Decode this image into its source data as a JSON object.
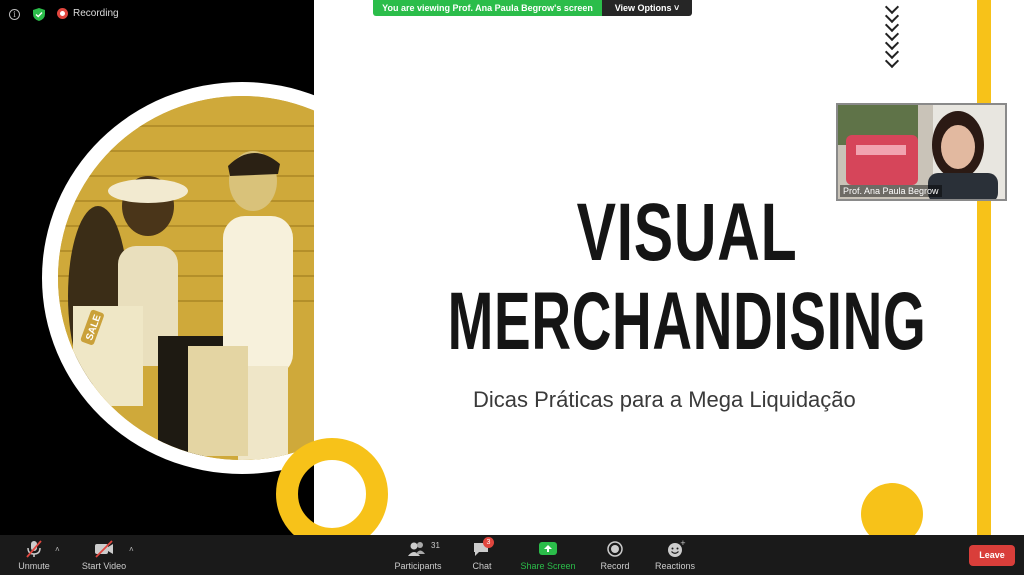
{
  "topbar": {
    "recording_label": "Recording",
    "viewing_banner": "You are viewing Prof. Ana Paula Begrow's screen",
    "view_options_label": "View Options"
  },
  "slide": {
    "title_line1": "VISUAL",
    "title_line2": "MERCHANDISING",
    "subtitle": "Dicas Práticas para a Mega Liquidação",
    "bag_tag": "SALE"
  },
  "self_video": {
    "name": "Prof. Ana Paula Begrow"
  },
  "toolbar": {
    "unmute_label": "Unmute",
    "start_video_label": "Start Video",
    "participants_label": "Participants",
    "participants_count": "31",
    "chat_label": "Chat",
    "chat_badge": "3",
    "share_screen_label": "Share Screen",
    "record_label": "Record",
    "reactions_label": "Reactions",
    "leave_label": "Leave"
  },
  "colors": {
    "accent_yellow": "#f7c219",
    "banner_green": "#2bbd4a",
    "leave_red": "#d93e3a"
  }
}
